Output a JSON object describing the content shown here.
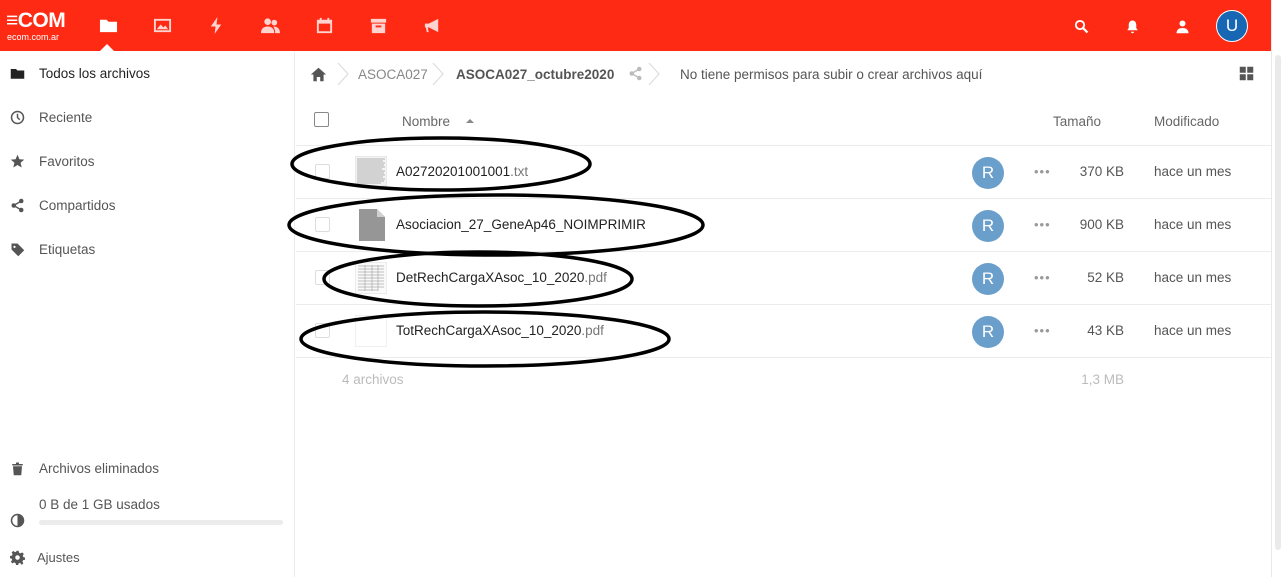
{
  "logo": {
    "text": "≡COM",
    "sub": "ecom.com.ar"
  },
  "header": {
    "apps": [
      "folder-icon",
      "image-icon",
      "lightning-icon",
      "contacts-icon",
      "calendar-icon",
      "archive-icon",
      "megaphone-icon"
    ],
    "avatar_initial": "U",
    "accent_color": "#ff2a14"
  },
  "sidebar": {
    "items": [
      {
        "label": "Todos los archivos",
        "icon": "folder-icon"
      },
      {
        "label": "Reciente",
        "icon": "clock-icon"
      },
      {
        "label": "Favoritos",
        "icon": "star-icon"
      },
      {
        "label": "Compartidos",
        "icon": "share-icon"
      },
      {
        "label": "Etiquetas",
        "icon": "tag-icon"
      }
    ],
    "deleted": "Archivos eliminados",
    "quota": "0 B de 1 GB usados",
    "settings": "Ajustes"
  },
  "breadcrumb": {
    "parent": "ASOCA027",
    "current": "ASOCA027_octubre2020",
    "message": "No tiene permisos para subir o crear archivos aquí"
  },
  "table": {
    "col_name": "Nombre",
    "col_size": "Tamaño",
    "col_modified": "Modificado",
    "files": [
      {
        "base": "A02720201001001",
        "ext": ".txt",
        "sharer": "R",
        "size": "370 KB",
        "modified": "hace un mes",
        "thumb": "text-thumb"
      },
      {
        "base": "Asociacion_27_GeneAp46_NOIMPRIMIR",
        "ext": "",
        "sharer": "R",
        "size": "900 KB",
        "modified": "hace un mes",
        "thumb": "file-icon"
      },
      {
        "base": "DetRechCargaXAsoc_10_2020",
        "ext": ".pdf",
        "sharer": "R",
        "size": "52 KB",
        "modified": "hace un mes",
        "thumb": "pdf-thumb"
      },
      {
        "base": "TotRechCargaXAsoc_10_2020",
        "ext": ".pdf",
        "sharer": "R",
        "size": "43 KB",
        "modified": "hace un mes",
        "thumb": "pdf-thumb-blank"
      }
    ],
    "more_label": "•••",
    "summary_count": "4 archivos",
    "summary_size": "1,3 MB"
  }
}
